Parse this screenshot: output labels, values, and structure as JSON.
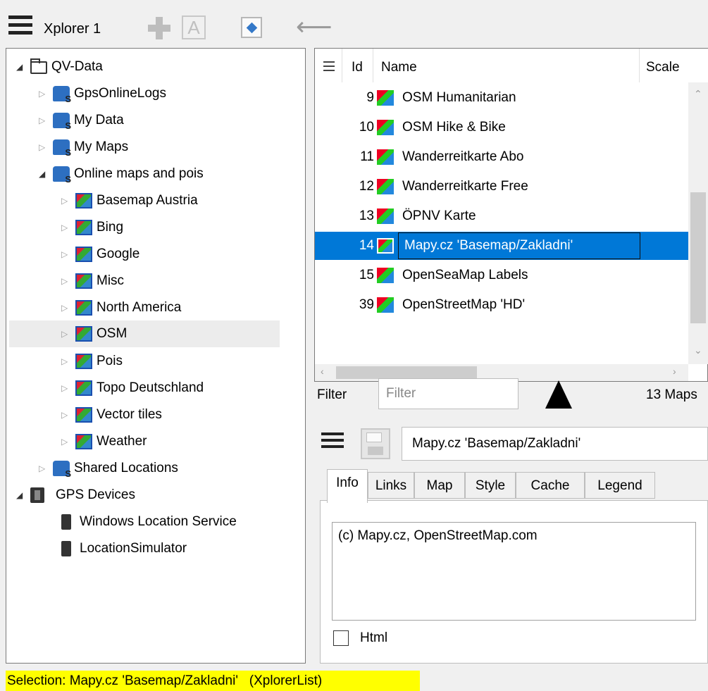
{
  "toolbar": {
    "title": "Xplorer 1",
    "icons": [
      "menu-icon",
      "plus-icon",
      "text-a-icon",
      "navigate-icon",
      "back-arrow-icon"
    ]
  },
  "tree": {
    "items": [
      {
        "label": "QV-Data",
        "icon": "folder-icon",
        "level": 0,
        "expanded": true
      },
      {
        "label": "GpsOnlineLogs",
        "icon": "database-icon",
        "level": 1,
        "expanded": false
      },
      {
        "label": "My Data",
        "icon": "database-icon",
        "level": 1,
        "expanded": false
      },
      {
        "label": "My Maps",
        "icon": "database-icon",
        "level": 1,
        "expanded": false
      },
      {
        "label": "Online maps and pois",
        "icon": "database-icon",
        "level": 1,
        "expanded": true
      },
      {
        "label": "Basemap Austria",
        "icon": "map-layer-icon",
        "level": 2,
        "expanded": false
      },
      {
        "label": "Bing",
        "icon": "map-layer-icon",
        "level": 2,
        "expanded": false
      },
      {
        "label": "Google",
        "icon": "map-layer-icon",
        "level": 2,
        "expanded": false
      },
      {
        "label": "Misc",
        "icon": "map-layer-icon",
        "level": 2,
        "expanded": false
      },
      {
        "label": "North America",
        "icon": "map-layer-icon",
        "level": 2,
        "expanded": false
      },
      {
        "label": "OSM",
        "icon": "map-layer-icon",
        "level": 2,
        "expanded": false,
        "hover": true
      },
      {
        "label": "Pois",
        "icon": "map-layer-icon",
        "level": 2,
        "expanded": false
      },
      {
        "label": "Topo Deutschland",
        "icon": "map-layer-icon",
        "level": 2,
        "expanded": false
      },
      {
        "label": "Vector tiles",
        "icon": "map-layer-icon",
        "level": 2,
        "expanded": false
      },
      {
        "label": "Weather",
        "icon": "map-layer-icon",
        "level": 2,
        "expanded": false
      },
      {
        "label": "Shared Locations",
        "icon": "database-icon",
        "level": 1,
        "expanded": false
      },
      {
        "label": "GPS Devices",
        "icon": "gps-devices-icon",
        "level": 0,
        "expanded": true
      },
      {
        "label": "Windows Location Service",
        "icon": "phone-icon",
        "level": 2
      },
      {
        "label": "LocationSimulator",
        "icon": "phone-icon",
        "level": 2
      }
    ]
  },
  "list": {
    "headers": {
      "id": "Id",
      "name": "Name",
      "scale": "Scale"
    },
    "rows": [
      {
        "id": "9",
        "name": "OSM Humanitarian"
      },
      {
        "id": "10",
        "name": "OSM Hike & Bike"
      },
      {
        "id": "11",
        "name": "Wanderreitkarte Abo"
      },
      {
        "id": "12",
        "name": "Wanderreitkarte Free"
      },
      {
        "id": "13",
        "name": "ÖPNV Karte"
      },
      {
        "id": "14",
        "name": "Mapy.cz 'Basemap/Zakladni'",
        "selected": true
      },
      {
        "id": "15",
        "name": "OpenSeaMap Labels"
      },
      {
        "id": "39",
        "name": "OpenStreetMap 'HD'"
      }
    ]
  },
  "filter": {
    "label": "Filter",
    "placeholder": "Filter",
    "value": "",
    "count": "13 Maps"
  },
  "detail": {
    "name": "Mapy.cz 'Basemap/Zakladni'",
    "tabs": [
      "Info",
      "Links",
      "Map",
      "Style",
      "Cache",
      "Legend"
    ],
    "active_tab": "Info",
    "info_text": "(c) Mapy.cz, OpenStreetMap.com",
    "html_label": "Html",
    "html_checked": false
  },
  "status": {
    "text": "Selection: Mapy.cz 'Basemap/Zakladni'   (XplorerList)"
  },
  "colors": {
    "selection": "#0078d7",
    "status_bg": "#ffff00"
  }
}
